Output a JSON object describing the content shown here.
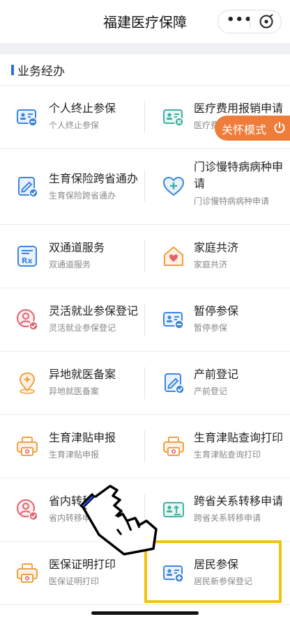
{
  "header": {
    "title": "福建医疗保障",
    "more_icon": "more-icon",
    "close_icon": "close-circle-icon"
  },
  "section": {
    "title": "业务经办"
  },
  "care_mode": {
    "label": "关怀模式",
    "icon": "power-icon"
  },
  "services": [
    {
      "name": "个人终止参保",
      "sub": "个人终止参保",
      "icon": "id-card-minus-icon"
    },
    {
      "name": "医疗费用报销申请",
      "sub": "医疗费",
      "icon": "id-card-x-icon"
    },
    {
      "name": "生育保险跨省通办",
      "sub": "生育保险跨省通办",
      "icon": "doc-edit-check-icon"
    },
    {
      "name": "门诊慢特病病种申请",
      "sub": "门诊慢特病病种申请",
      "icon": "heart-plus-icon"
    },
    {
      "name": "双通道服务",
      "sub": "双通道服务",
      "icon": "rx-icon"
    },
    {
      "name": "家庭共济",
      "sub": "家庭共济",
      "icon": "house-heart-icon"
    },
    {
      "name": "灵活就业参保登记",
      "sub": "灵活就业参保登记",
      "icon": "person-check-icon"
    },
    {
      "name": "暂停参保",
      "sub": "暂停参保",
      "icon": "id-card-minus-icon"
    },
    {
      "name": "异地就医备案",
      "sub": "异地就医备案",
      "icon": "location-plus-icon"
    },
    {
      "name": "产前登记",
      "sub": "产前登记",
      "icon": "doc-edit-check-icon"
    },
    {
      "name": "生育津贴申报",
      "sub": "生育津贴申报",
      "icon": "printer-icon"
    },
    {
      "name": "生育津贴查询打印",
      "sub": "生育津贴查询打印",
      "icon": "printer-icon"
    },
    {
      "name": "省内转移申请",
      "sub": "省内转移申请",
      "icon": "person-check-icon"
    },
    {
      "name": "跨省关系转移申请",
      "sub": "跨省关系转移申请",
      "icon": "id-card-transfer-icon"
    },
    {
      "name": "医保证明打印",
      "sub": "医保证明打印",
      "icon": "printer-icon"
    },
    {
      "name": "居民参保",
      "sub": "居民新参保登记",
      "icon": "id-card-add-icon"
    }
  ],
  "colors": {
    "accent": "#2f6fe0",
    "care": "#ee7d3c",
    "highlight": "#f1c40f",
    "icon_teal": "#3fb2a0",
    "icon_orange": "#f0a040",
    "icon_red": "#e0646e"
  }
}
